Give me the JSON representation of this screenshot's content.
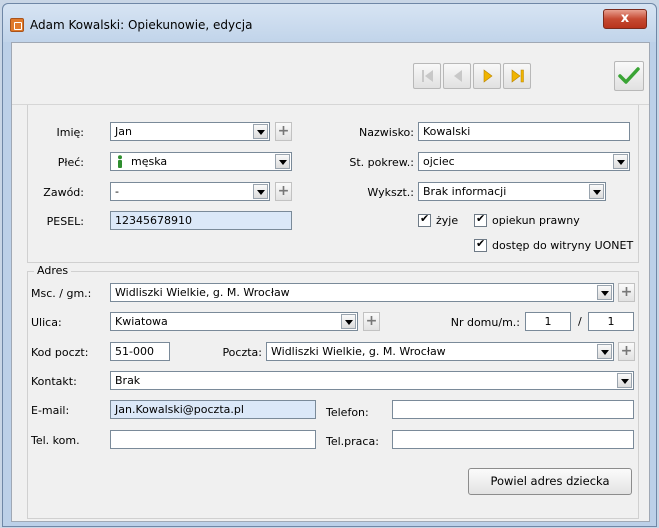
{
  "window": {
    "title": "Adam Kowalski: Opiekunowie, edycja",
    "close_label": "x"
  },
  "toolbar": {
    "icons": [
      "first-record-icon",
      "prev-record-icon",
      "next-record-icon",
      "last-record-icon",
      "confirm-check-icon"
    ]
  },
  "person": {
    "imie_label": "Imię:",
    "imie_value": "Jan",
    "nazwisko_label": "Nazwisko:",
    "nazwisko_value": "Kowalski",
    "plec_label": "Płeć:",
    "plec_value": "męska",
    "pokrew_label": "St. pokrew.:",
    "pokrew_value": "ojciec",
    "zawod_label": "Zawód:",
    "zawod_value": "-",
    "wyksz_label": "Wykszt.:",
    "wyksz_value": "Brak informacji",
    "pesel_label": "PESEL:",
    "pesel_value": "12345678910",
    "zyje_label": "żyje",
    "zyje_checked": true,
    "opiekun_label": "opiekun prawny",
    "opiekun_checked": true,
    "dostep_label": "dostęp do witryny UONET",
    "dostep_checked": true
  },
  "address": {
    "legend": "Adres",
    "msc_label": "Msc. / gm.:",
    "msc_value": "Widliszki Wielkie, g. M. Wrocław",
    "ulica_label": "Ulica:",
    "ulica_value": "Kwiatowa",
    "nrdomu_label": "Nr domu/m.:",
    "nrdomu_value": "1",
    "nr_sep": "/",
    "nrmieszk_value": "1",
    "kod_label": "Kod poczt:",
    "kod_value": "51-000",
    "poczta_label": "Poczta:",
    "poczta_value": "Widliszki Wielkie, g. M. Wrocław",
    "kontakt_label": "Kontakt:",
    "kontakt_value": "Brak",
    "email_label": "E-mail:",
    "email_value": "Jan.Kowalski@poczta.pl",
    "telefon_label": "Telefon:",
    "telefon_value": "",
    "telkom_label": "Tel. kom.",
    "telkom_value": "",
    "telpraca_label": "Tel.praca:",
    "telpraca_value": "",
    "copy_button": "Powiel adres dziecka"
  }
}
